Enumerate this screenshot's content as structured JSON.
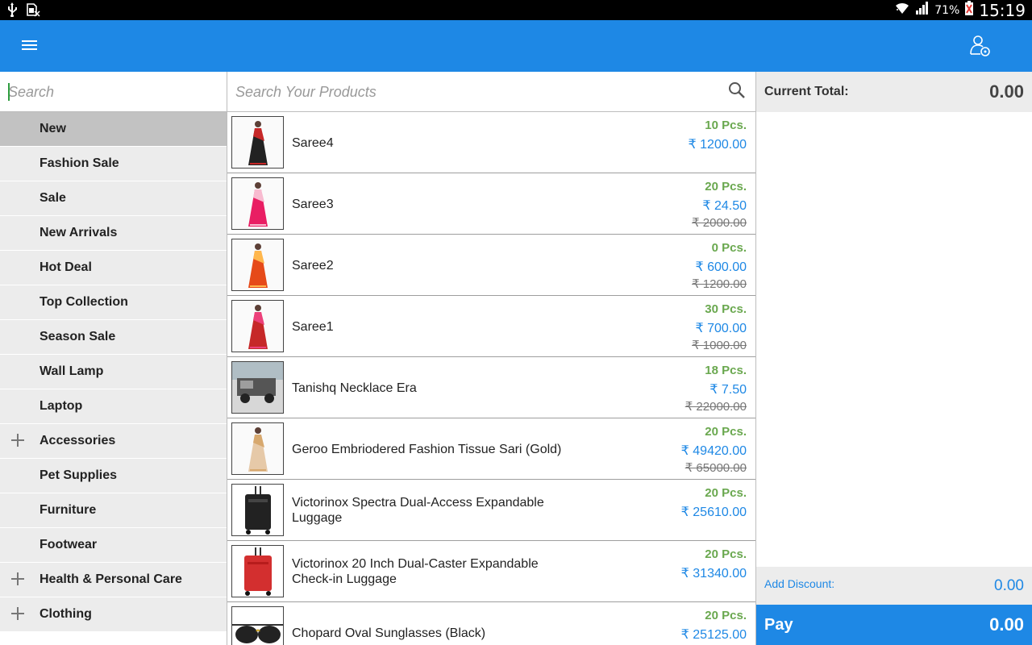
{
  "status_bar": {
    "battery_percent": "71%",
    "time": "15:19",
    "icons": [
      "usb-icon",
      "sim-missing-icon",
      "wifi-icon",
      "signal-icon",
      "battery-icon"
    ]
  },
  "app_bar": {
    "color": "#1e88e5",
    "menu_icon": "menu-icon",
    "user_icon": "customer-settings-icon"
  },
  "category_search": {
    "placeholder": "Search",
    "value": ""
  },
  "categories": [
    {
      "label": "New",
      "active": true,
      "expandable": false
    },
    {
      "label": "Fashion Sale",
      "active": false,
      "expandable": false
    },
    {
      "label": "Sale",
      "active": false,
      "expandable": false
    },
    {
      "label": "New Arrivals",
      "active": false,
      "expandable": false
    },
    {
      "label": "Hot Deal",
      "active": false,
      "expandable": false
    },
    {
      "label": "Top Collection",
      "active": false,
      "expandable": false
    },
    {
      "label": "Season Sale",
      "active": false,
      "expandable": false
    },
    {
      "label": "Wall Lamp",
      "active": false,
      "expandable": false
    },
    {
      "label": "Laptop",
      "active": false,
      "expandable": false
    },
    {
      "label": "Accessories",
      "active": false,
      "expandable": true
    },
    {
      "label": "Pet Supplies",
      "active": false,
      "expandable": false
    },
    {
      "label": "Furniture",
      "active": false,
      "expandable": false
    },
    {
      "label": "Footwear",
      "active": false,
      "expandable": false
    },
    {
      "label": "Health & Personal Care",
      "active": false,
      "expandable": true
    },
    {
      "label": "Clothing",
      "active": false,
      "expandable": true
    }
  ],
  "product_search": {
    "placeholder": "Search Your Products",
    "value": ""
  },
  "products": [
    {
      "name": "Saree4",
      "qty": "10 Pcs.",
      "price": "₹ 1200.00",
      "mrp": "",
      "image": "saree-dark"
    },
    {
      "name": "Saree3",
      "qty": "20 Pcs.",
      "price": "₹ 24.50",
      "mrp": "₹ 2000.00",
      "image": "saree-pink"
    },
    {
      "name": "Saree2",
      "qty": "0 Pcs.",
      "price": "₹ 600.00",
      "mrp": "₹ 1200.00",
      "image": "saree-orange"
    },
    {
      "name": "Saree1",
      "qty": "30 Pcs.",
      "price": "₹ 700.00",
      "mrp": "₹ 1000.00",
      "image": "saree-red"
    },
    {
      "name": "Tanishq Necklace Era",
      "qty": "18 Pcs.",
      "price": "₹ 7.50",
      "mrp": "₹ 22000.00",
      "image": "vehicle"
    },
    {
      "name": "Geroo Embriodered Fashion Tissue Sari  (Gold)",
      "qty": "20 Pcs.",
      "price": "₹ 49420.00",
      "mrp": "₹ 65000.00",
      "image": "saree-gold"
    },
    {
      "name": "Victorinox Spectra Dual-Access  Expandable Luggage",
      "qty": "20 Pcs.",
      "price": "₹ 25610.00",
      "mrp": "",
      "image": "luggage-black"
    },
    {
      "name": "Victorinox 20 Inch Dual-Caster Expandable Check-in Luggage",
      "qty": "20 Pcs.",
      "price": "₹ 31340.00",
      "mrp": "",
      "image": "luggage-red"
    },
    {
      "name": "Chopard Oval Sunglasses  (Black)",
      "qty": "20 Pcs.",
      "price": "₹ 25125.00",
      "mrp": "",
      "image": "sunglasses"
    }
  ],
  "cart": {
    "total_label": "Current Total:",
    "total_value": "0.00",
    "discount_label": "Add Discount:",
    "discount_value": "0.00",
    "pay_label": "Pay",
    "pay_value": "0.00"
  },
  "colors": {
    "accent": "#1e88e5",
    "stock_green": "#6aa84f",
    "panel_grey": "#ececec",
    "active_grey": "#c2c2c2"
  }
}
